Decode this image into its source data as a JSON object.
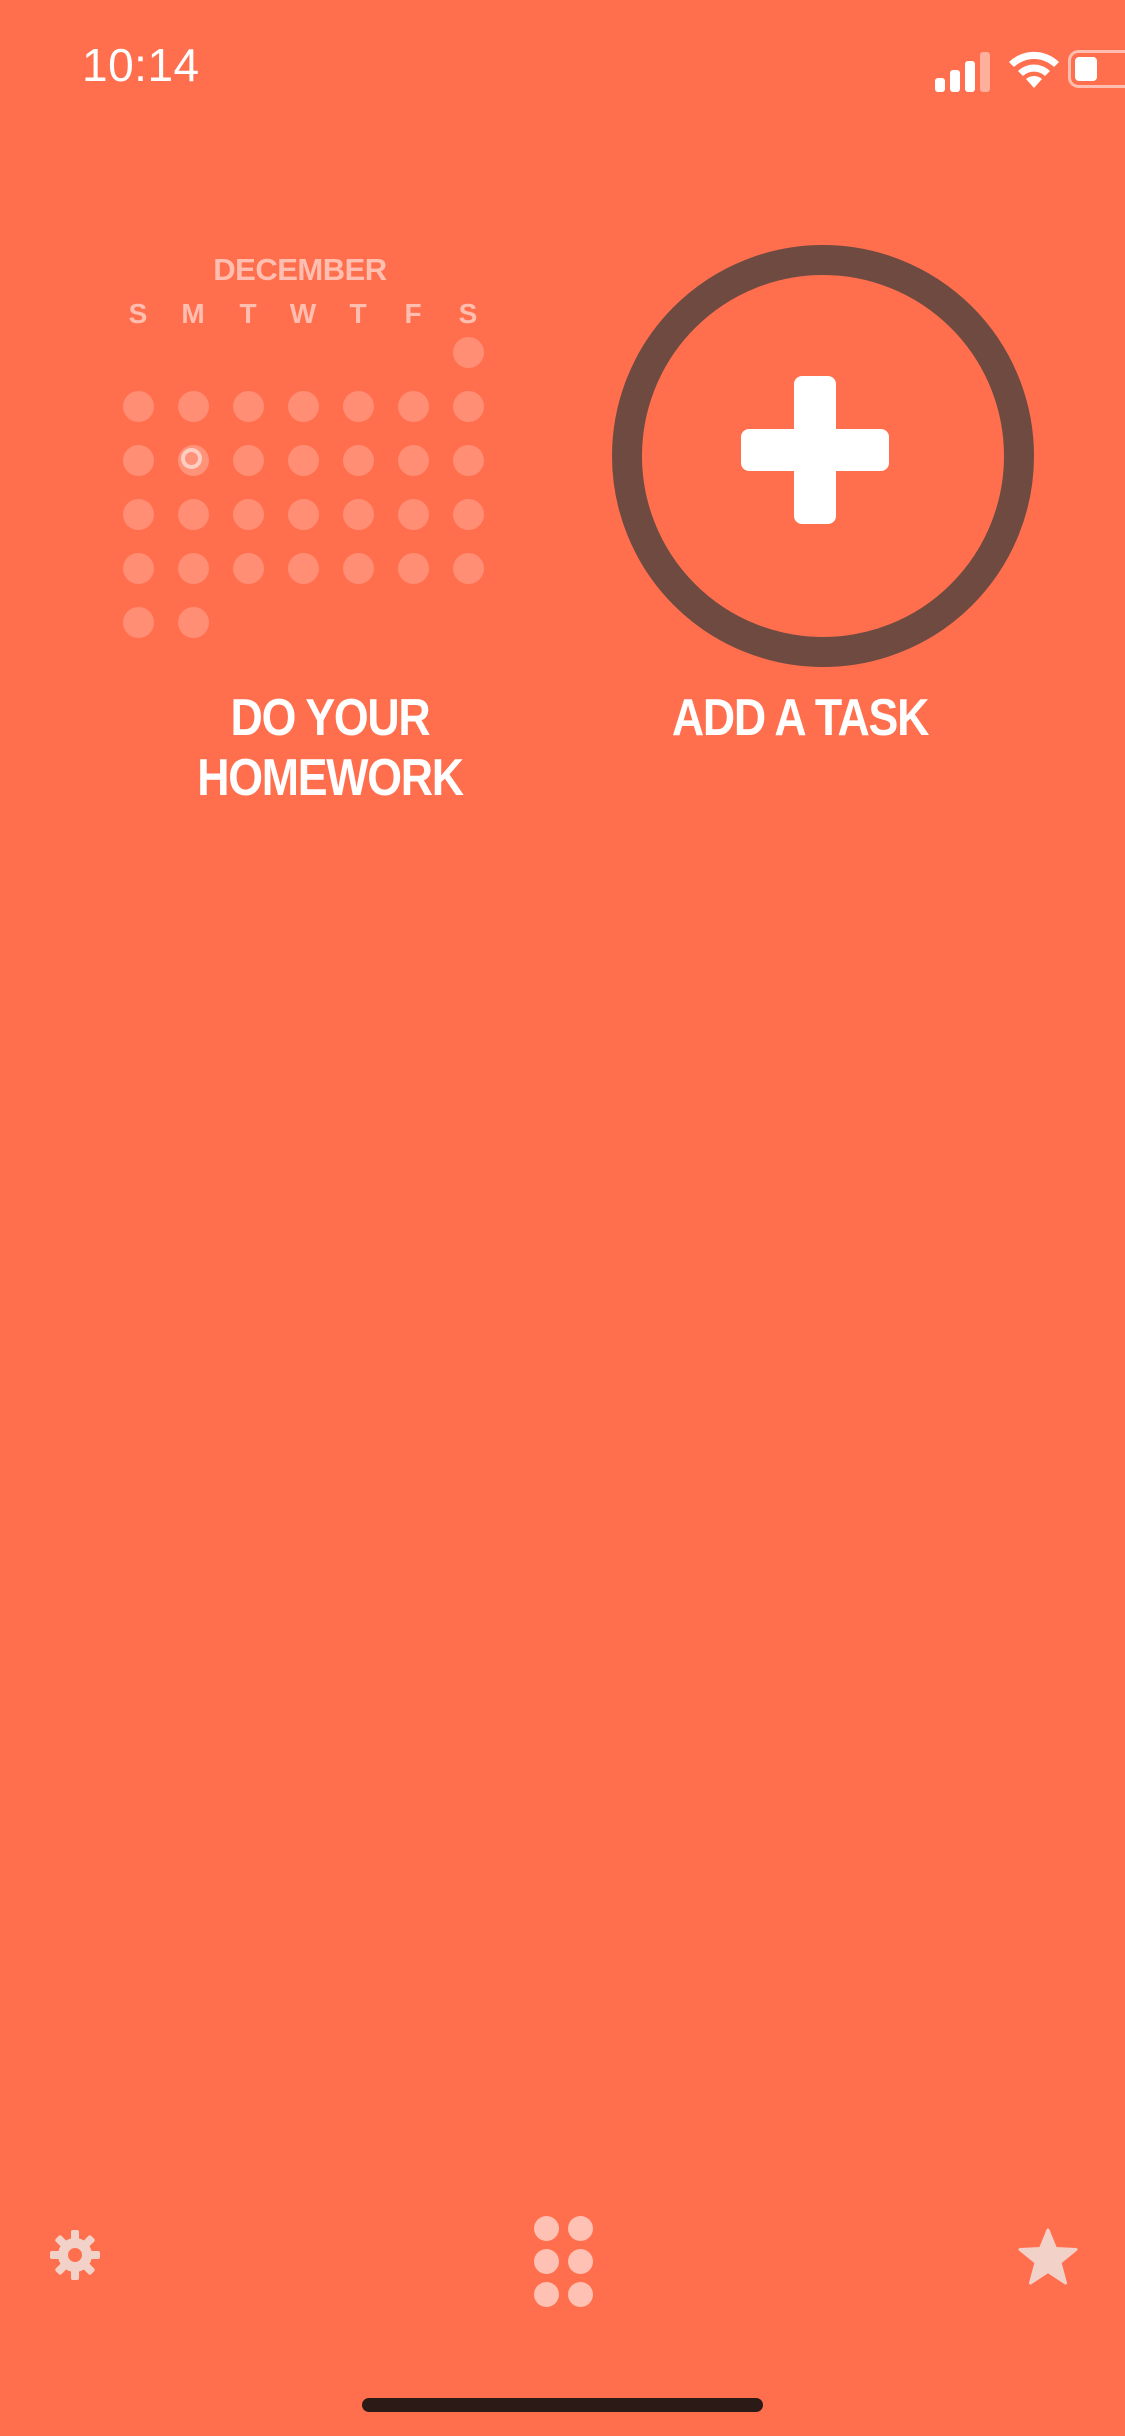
{
  "status_bar": {
    "time": "10:14",
    "icons": [
      "signal-icon",
      "wifi-icon",
      "battery-icon"
    ]
  },
  "calendar": {
    "month": "DECEMBER",
    "weekdays": [
      "S",
      "M",
      "T",
      "W",
      "T",
      "F",
      "S"
    ],
    "days_in_month": 31,
    "first_weekday_index": 6,
    "today": 10
  },
  "tiles": {
    "homework_label": "DO YOUR HOMEWORK",
    "add_label": "ADD A TASK"
  },
  "bottom_bar": {
    "icons": [
      "gear-icon",
      "grid-icon",
      "star-icon"
    ]
  },
  "colors": {
    "background": "#FF6F4E",
    "ring": "#6F4A40",
    "accent_light": "#FFC1B3",
    "home_indicator": "#2B1A16"
  }
}
